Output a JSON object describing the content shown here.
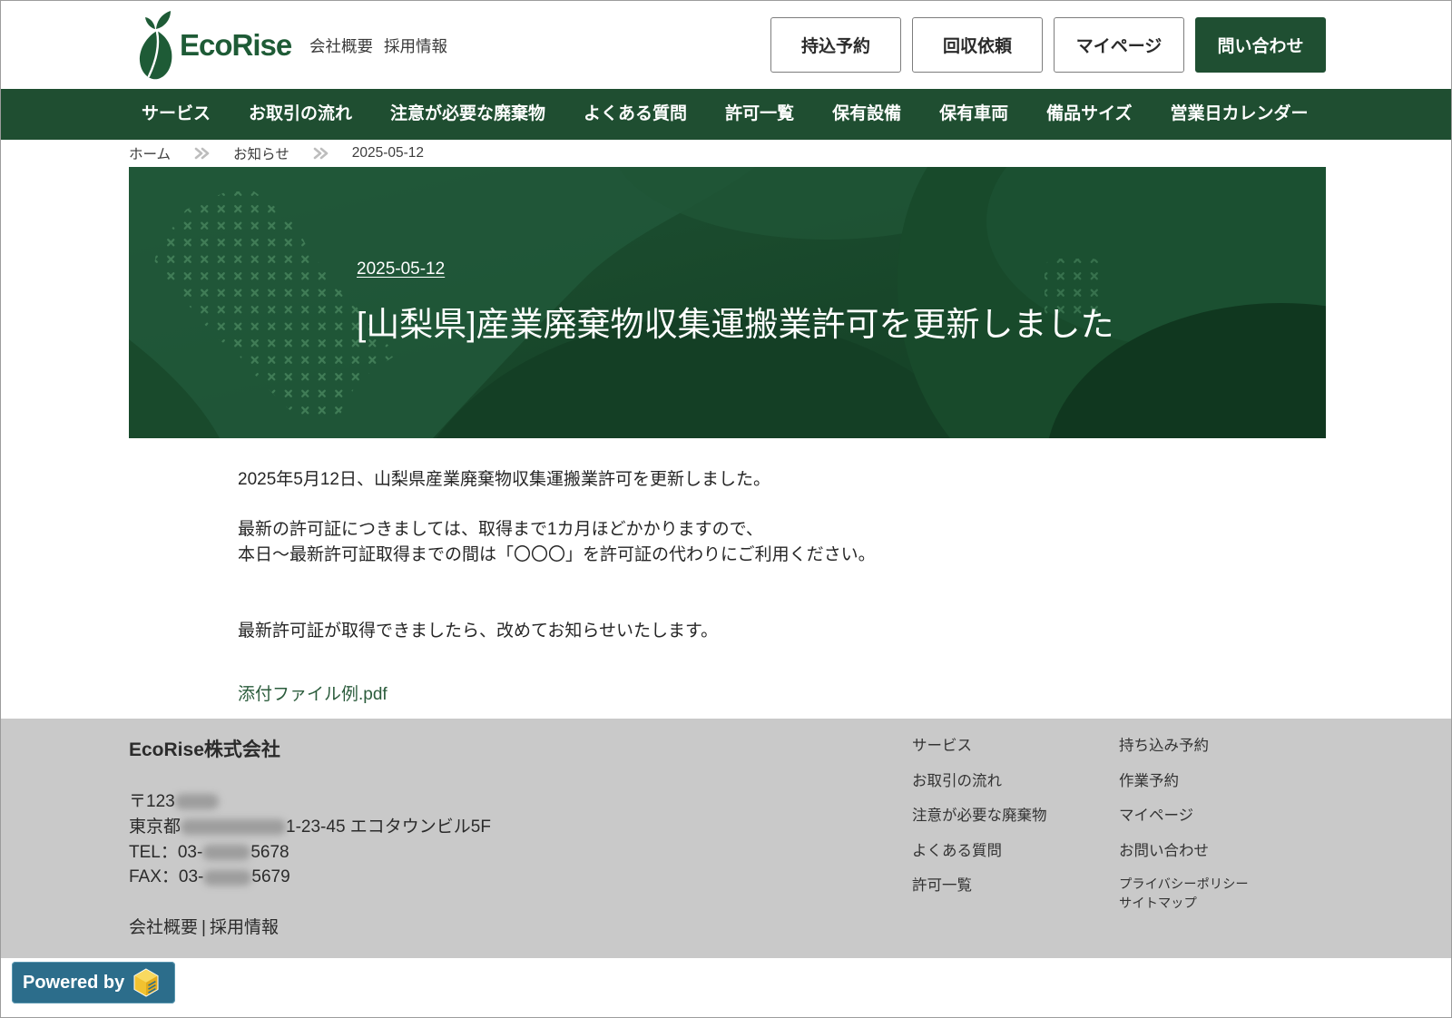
{
  "colors": {
    "brand_green": "#1e5b36",
    "nav_background": "#1f4e31",
    "hero_background": "#1b4c2e",
    "footer_background": "#c9c9c9",
    "attachment_link": "#2b5c3c",
    "powered_badge": "#2c6d8b",
    "powered_icon": "#f2c230"
  },
  "header": {
    "logo": {
      "text": "EcoRise",
      "icon": "sprout-leaf-logo-icon"
    },
    "links": {
      "company": "会社概要",
      "recruit": "採用情報"
    },
    "buttons": {
      "drop_off": "持込予約",
      "pickup": "回収依頼",
      "mypage": "マイページ",
      "contact": "問い合わせ"
    }
  },
  "nav": {
    "items": [
      "サービス",
      "お取引の流れ",
      "注意が必要な廃棄物",
      "よくある質問",
      "許可一覧",
      "保有設備",
      "保有車両",
      "備品サイズ",
      "営業日カレンダー"
    ]
  },
  "breadcrumb": {
    "home": "ホーム",
    "news": "お知らせ",
    "current": "2025-05-12",
    "separator_icon": "double-chevron-right-icon"
  },
  "hero": {
    "date": "2025-05-12",
    "title": "[山梨県]産業廃棄物収集運搬業許可を更新しました"
  },
  "article": {
    "p1": "2025年5月12日、山梨県産業廃棄物収集運搬業許可を更新しました。",
    "p2": [
      "最新の許可証につきましては、取得まで1カ月ほどかかりますので、",
      "本日～最新許可証取得までの間は「〇〇〇」を許可証の代わりにご利用ください。"
    ],
    "p3": "最新許可証が取得できましたら、改めてお知らせいたします。",
    "attachment": "添付ファイル例.pdf"
  },
  "footer": {
    "company": "EcoRise株式会社",
    "address": [
      {
        "before": "〒123"
      },
      {
        "before": "東京都",
        "after": "1-23-45 エコタウンビル5F"
      },
      {
        "before": "TEL：03-",
        "after": "5678"
      },
      {
        "before": "FAX：03-",
        "after": "5679"
      }
    ],
    "bottom_links": [
      "会社概要",
      "採用情報"
    ],
    "separator": "|",
    "col1": [
      "サービス",
      "お取引の流れ",
      "注意が必要な廃棄物",
      "よくある質問",
      "許可一覧"
    ],
    "col2": [
      "持ち込み予約",
      "作業予約",
      "マイページ",
      "お問い合わせ"
    ],
    "col2_small": [
      "プライバシーポリシー",
      "サイトマップ"
    ]
  },
  "powered_by": {
    "label": "Powered by",
    "icon": "cube-logo-icon"
  }
}
